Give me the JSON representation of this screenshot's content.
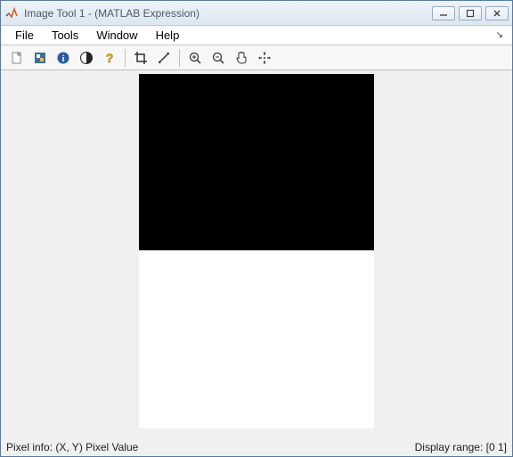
{
  "title": "Image Tool 1 - (MATLAB Expression)",
  "menu": {
    "file": "File",
    "tools": "Tools",
    "window": "Window",
    "help": "Help"
  },
  "status": {
    "pixel_info": "Pixel info: (X, Y)  Pixel Value",
    "display_range": "Display range: [0 1]"
  }
}
